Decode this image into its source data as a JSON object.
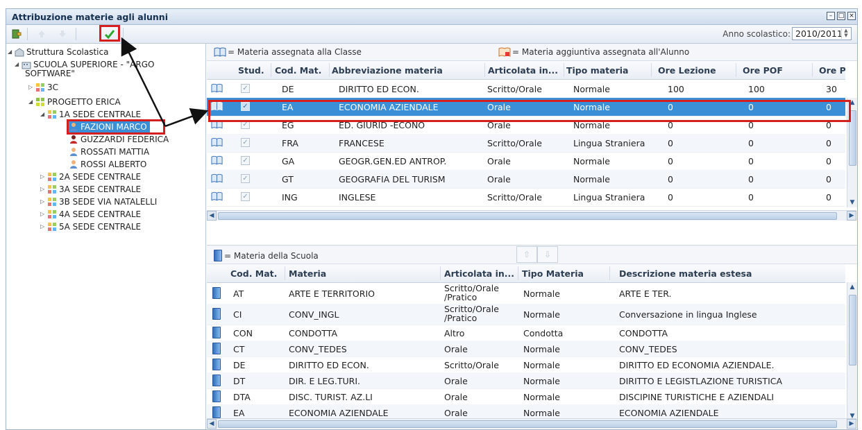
{
  "window": {
    "title": "Attribuzione materie agli alunni",
    "controls": [
      "minimize",
      "maximize",
      "close"
    ]
  },
  "toolbar": {
    "anno_label": "Anno scolastico:",
    "anno_value": "2010/2011"
  },
  "tree": {
    "root": "Struttura Scolastica",
    "school_line1": "SCUOLA SUPERIORE - \"ARGO",
    "school_line2": "SOFTWARE\"",
    "nodes": [
      "3C",
      "PROGETTO ERICA",
      "1A SEDE CENTRALE"
    ],
    "students": [
      "FAZIONI MARCO",
      "GUZZARDI FEDERICA",
      "ROSSATI MATTIA",
      "ROSSI ALBERTO"
    ],
    "classes": [
      "2A SEDE CENTRALE",
      "3A SEDE CENTRALE",
      "3B SEDE VIA NATALELLI",
      "4A SEDE CENTRALE",
      "5A SEDE CENTRALE"
    ]
  },
  "legend_top": {
    "class_subject": "= Materia assegnata alla Classe",
    "extra_subject": "= Materia aggiuntiva assegnata all'Alunno"
  },
  "grid_top": {
    "headers": [
      "Stud.",
      "Cod. Mat.",
      "Abbreviazione materia",
      "Articolata in...",
      "Tipo materia",
      "Ore Lezione",
      "Ore POF",
      "Ore Pe"
    ],
    "rows": [
      {
        "cod": "DE",
        "abbr": "DIRITTO ED ECON.",
        "art": "Scritto/Orale",
        "tipo": "Normale",
        "ore_lez": "100",
        "ore_pof": "100",
        "ore_pe": "30"
      },
      {
        "cod": "EA",
        "abbr": "ECONOMIA AZIENDALE",
        "art": "Orale",
        "tipo": "Normale",
        "ore_lez": "0",
        "ore_pof": "0",
        "ore_pe": "0"
      },
      {
        "cod": "EG",
        "abbr": "ED. GIURID -ECONO",
        "art": "Orale",
        "tipo": "Normale",
        "ore_lez": "0",
        "ore_pof": "0",
        "ore_pe": "0"
      },
      {
        "cod": "FRA",
        "abbr": "FRANCESE",
        "art": "Scritto/Orale",
        "tipo": "Lingua Straniera",
        "ore_lez": "0",
        "ore_pof": "0",
        "ore_pe": "0"
      },
      {
        "cod": "GA",
        "abbr": "GEOGR.GEN.ED ANTROP.",
        "art": "Orale",
        "tipo": "Normale",
        "ore_lez": "0",
        "ore_pof": "0",
        "ore_pe": "0"
      },
      {
        "cod": "GT",
        "abbr": "GEOGRAFIA DEL TURISM",
        "art": "Orale",
        "tipo": "Normale",
        "ore_lez": "0",
        "ore_pof": "0",
        "ore_pe": "0"
      },
      {
        "cod": "ING",
        "abbr": "INGLESE",
        "art": "Scritto/Orale",
        "tipo": "Lingua Straniera",
        "ore_lez": "0",
        "ore_pof": "0",
        "ore_pe": "0"
      }
    ]
  },
  "legend_bottom": {
    "school_subject": "= Materia della Scuola"
  },
  "grid_bottom": {
    "headers": [
      "Cod. Mat.",
      "Materia",
      "Articolata in...",
      "Tipo Materia",
      "Descrizione materia estesa"
    ],
    "rows": [
      {
        "cod": "AT",
        "mat": "ARTE E TERRITORIO",
        "art": "Scritto/Orale\n/Pratico",
        "tipo": "Normale",
        "desc": "ARTE E TER."
      },
      {
        "cod": "CI",
        "mat": "CONV_INGL",
        "art": "Scritto/Orale\n/Pratico",
        "tipo": "Normale",
        "desc": "Conversazione in lingua Inglese"
      },
      {
        "cod": "CON",
        "mat": "CONDOTTA",
        "art": "Altro",
        "tipo": "Condotta",
        "desc": "CONDOTTA"
      },
      {
        "cod": "CT",
        "mat": "CONV_TEDES",
        "art": "Orale",
        "tipo": "Normale",
        "desc": "CONV_TEDES"
      },
      {
        "cod": "DE",
        "mat": "DIRITTO ED ECON.",
        "art": "Scritto/Orale",
        "tipo": "Normale",
        "desc": "DIRITTO ED ECONOMIA AZIENDALE."
      },
      {
        "cod": "DT",
        "mat": "DIR. E LEG.TURI.",
        "art": "Orale",
        "tipo": "Normale",
        "desc": "DIRITTO E LEGISTLAZIONE TURISTICA"
      },
      {
        "cod": "DTA",
        "mat": "DISC. TURIST. AZ.LI",
        "art": "Orale",
        "tipo": "Normale",
        "desc": "DISCIPINE TURISTICHE E AZIENDALI"
      },
      {
        "cod": "EA",
        "mat": "ECONOMIA AZIENDALE",
        "art": "Orale",
        "tipo": "Normale",
        "desc": "ECONOMIA AZIENDALE"
      }
    ]
  },
  "colors": {
    "selection": "#3b8fd6",
    "highlight": "#d51e1e",
    "title_bg": "#dbe5f1"
  },
  "icons": [
    "exit-icon",
    "move-up-icon",
    "move-down-icon",
    "confirm-check-icon",
    "school-icon",
    "class-group-icon",
    "student-icon",
    "book-icon",
    "subject-icon"
  ]
}
